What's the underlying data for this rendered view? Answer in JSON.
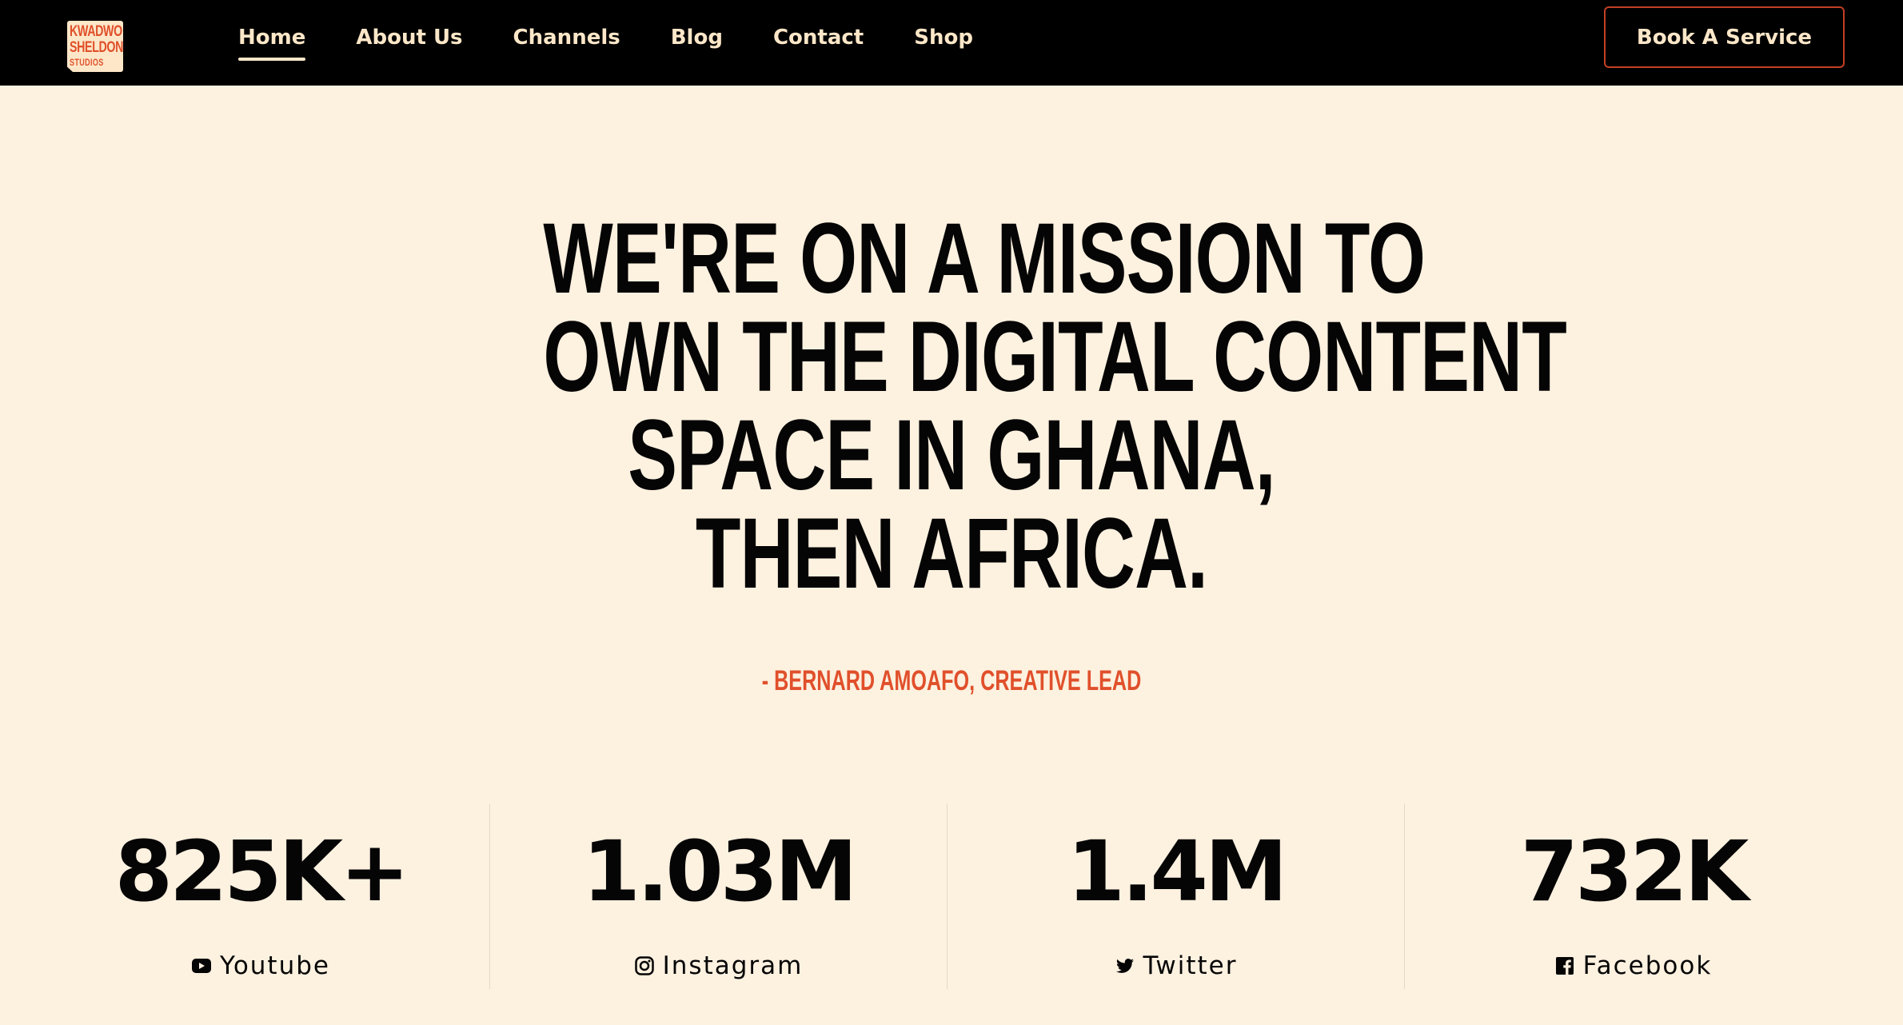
{
  "header": {
    "logo": {
      "line1": "KWADWO",
      "line2": "SHELDON",
      "line3": "STUDIOS"
    },
    "nav": [
      {
        "label": "Home",
        "active": true
      },
      {
        "label": "About Us",
        "active": false
      },
      {
        "label": "Channels",
        "active": false
      },
      {
        "label": "Blog",
        "active": false
      },
      {
        "label": "Contact",
        "active": false
      },
      {
        "label": "Shop",
        "active": false
      }
    ],
    "cta_label": "Book A Service"
  },
  "mission": {
    "lines": [
      "WE'RE ON A MISSION TO",
      "OWN THE DIGITAL CONTENT",
      "SPACE IN GHANA,",
      "THEN AFRICA."
    ],
    "attribution": "- BERNARD AMOAFO, CREATIVE LEAD"
  },
  "stats": [
    {
      "value": "825K+",
      "label": "Youtube",
      "icon": "youtube-icon"
    },
    {
      "value": "1.03M",
      "label": "Instagram",
      "icon": "instagram-icon"
    },
    {
      "value": "1.4M",
      "label": "Twitter",
      "icon": "twitter-icon"
    },
    {
      "value": "732K",
      "label": "Facebook",
      "icon": "facebook-icon"
    }
  ],
  "colors": {
    "background": "#fdf1e0",
    "header": "#000000",
    "accent": "#e0502b",
    "nav_text": "#fde7c8",
    "text": "#050505"
  }
}
